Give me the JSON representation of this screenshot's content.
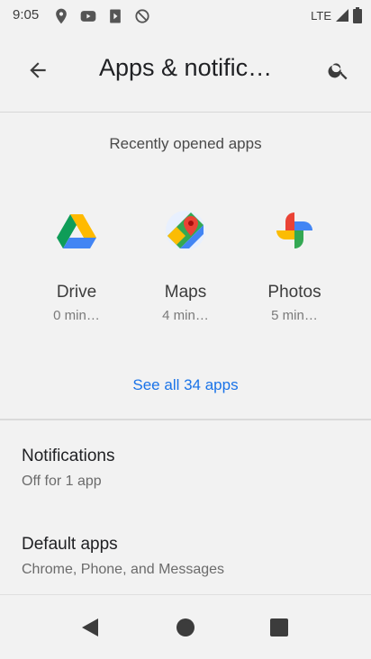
{
  "status_bar": {
    "time": "9:05",
    "network": "LTE",
    "icons": [
      "maps-icon",
      "youtube-icon",
      "play-store-icon",
      "no-sync-icon",
      "signal-icon",
      "battery-icon"
    ]
  },
  "app_bar": {
    "title": "Apps & notific…",
    "back_icon": "arrow-back-icon",
    "search_icon": "search-icon"
  },
  "recent": {
    "header": "Recently opened apps",
    "apps": [
      {
        "name": "Drive",
        "time": "0 min…",
        "icon": "drive-icon"
      },
      {
        "name": "Maps",
        "time": "4 min…",
        "icon": "maps-icon"
      },
      {
        "name": "Photos",
        "time": "5 min…",
        "icon": "photos-icon"
      }
    ],
    "see_all": "See all 34 apps"
  },
  "settings": [
    {
      "title": "Notifications",
      "subtitle": "Off for 1 app"
    },
    {
      "title": "Default apps",
      "subtitle": "Chrome, Phone, and Messages"
    }
  ],
  "nav_bar": {
    "icons": [
      "back-triangle-icon",
      "home-circle-icon",
      "recents-square-icon"
    ]
  },
  "colors": {
    "background": "#f2f2f2",
    "accent": "#1a73e8",
    "text_primary": "#202124",
    "text_secondary": "#6b6b6b"
  }
}
